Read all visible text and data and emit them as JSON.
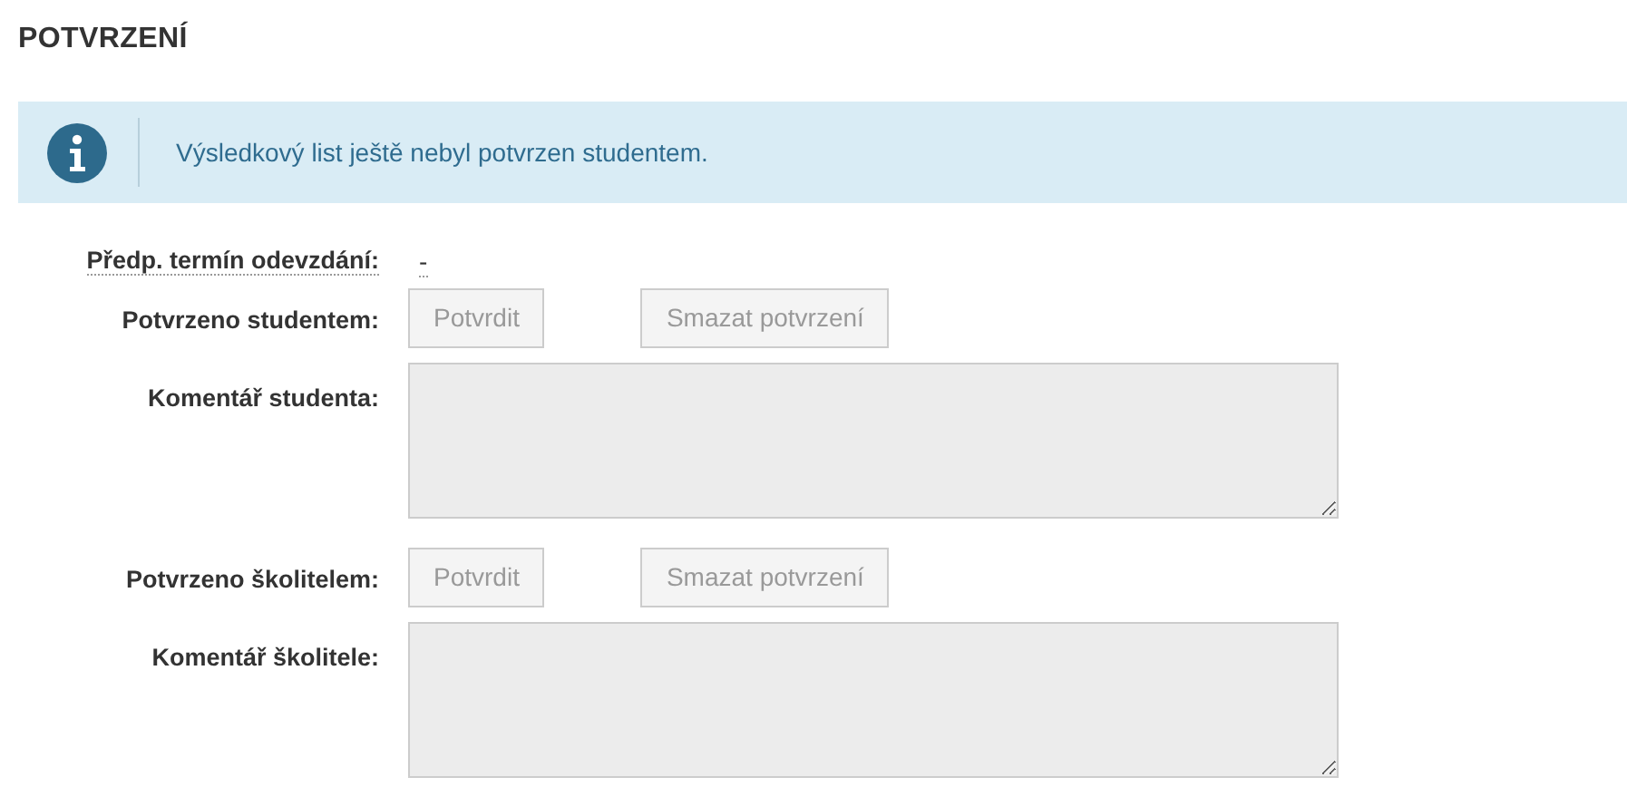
{
  "section_title": "POTVRZENÍ",
  "alert": {
    "text": "Výsledkový list ještě nebyl potvrzen studentem."
  },
  "fields": [
    {
      "kind": "text",
      "label": "Předp. termín odevzdání:",
      "value": "-",
      "dotted": true
    },
    {
      "kind": "buttons",
      "label": "Potvrzeno studentem:",
      "buttons": [
        {
          "label": "Potvrdit",
          "disabled": true
        },
        {
          "label": "Smazat potvrzení",
          "disabled": true
        }
      ]
    },
    {
      "kind": "textarea",
      "label": "Komentář studenta:",
      "disabled": true
    },
    {
      "kind": "buttons",
      "label": "Potvrzeno školitelem:",
      "buttons": [
        {
          "label": "Potvrdit",
          "disabled": true
        },
        {
          "label": "Smazat potvrzení",
          "disabled": true
        }
      ]
    },
    {
      "kind": "textarea",
      "label": "Komentář školitele:",
      "disabled": true
    }
  ]
}
